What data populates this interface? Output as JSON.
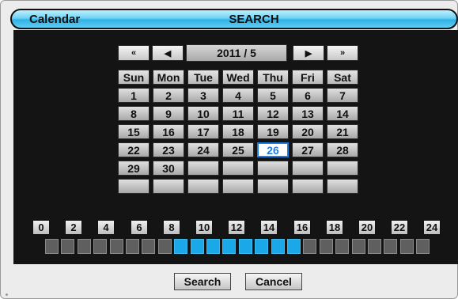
{
  "window": {
    "title_left": "Calendar",
    "title_center": "SEARCH"
  },
  "nav": {
    "prev_year_icon": "«",
    "prev_month_icon": "◀",
    "month_label": "2011 / 5",
    "next_month_icon": "▶",
    "next_year_icon": "»"
  },
  "weekdays": [
    "Sun",
    "Mon",
    "Tue",
    "Wed",
    "Thu",
    "Fri",
    "Sat"
  ],
  "calendar_rows": [
    [
      "1",
      "2",
      "3",
      "4",
      "5",
      "6",
      "7"
    ],
    [
      "8",
      "9",
      "10",
      "11",
      "12",
      "13",
      "14"
    ],
    [
      "15",
      "16",
      "17",
      "18",
      "19",
      "20",
      "21"
    ],
    [
      "22",
      "23",
      "24",
      "25",
      "26",
      "27",
      "28"
    ],
    [
      "29",
      "30",
      "",
      "",
      "",
      "",
      ""
    ],
    [
      "",
      "",
      "",
      "",
      "",
      "",
      ""
    ]
  ],
  "selected_day": "26",
  "hours": [
    "0",
    "2",
    "4",
    "6",
    "8",
    "10",
    "12",
    "14",
    "16",
    "18",
    "20",
    "22",
    "24"
  ],
  "hour_blocks_active": [
    false,
    false,
    false,
    false,
    false,
    false,
    false,
    false,
    true,
    true,
    true,
    true,
    true,
    true,
    true,
    true,
    false,
    false,
    false,
    false,
    false,
    false,
    false,
    false
  ],
  "colors": {
    "accent": "#1aa8e8",
    "selected_text": "#1a7fe8",
    "panel_bg": "#141414"
  },
  "footer": {
    "search_label": "Search",
    "cancel_label": "Cancel"
  }
}
